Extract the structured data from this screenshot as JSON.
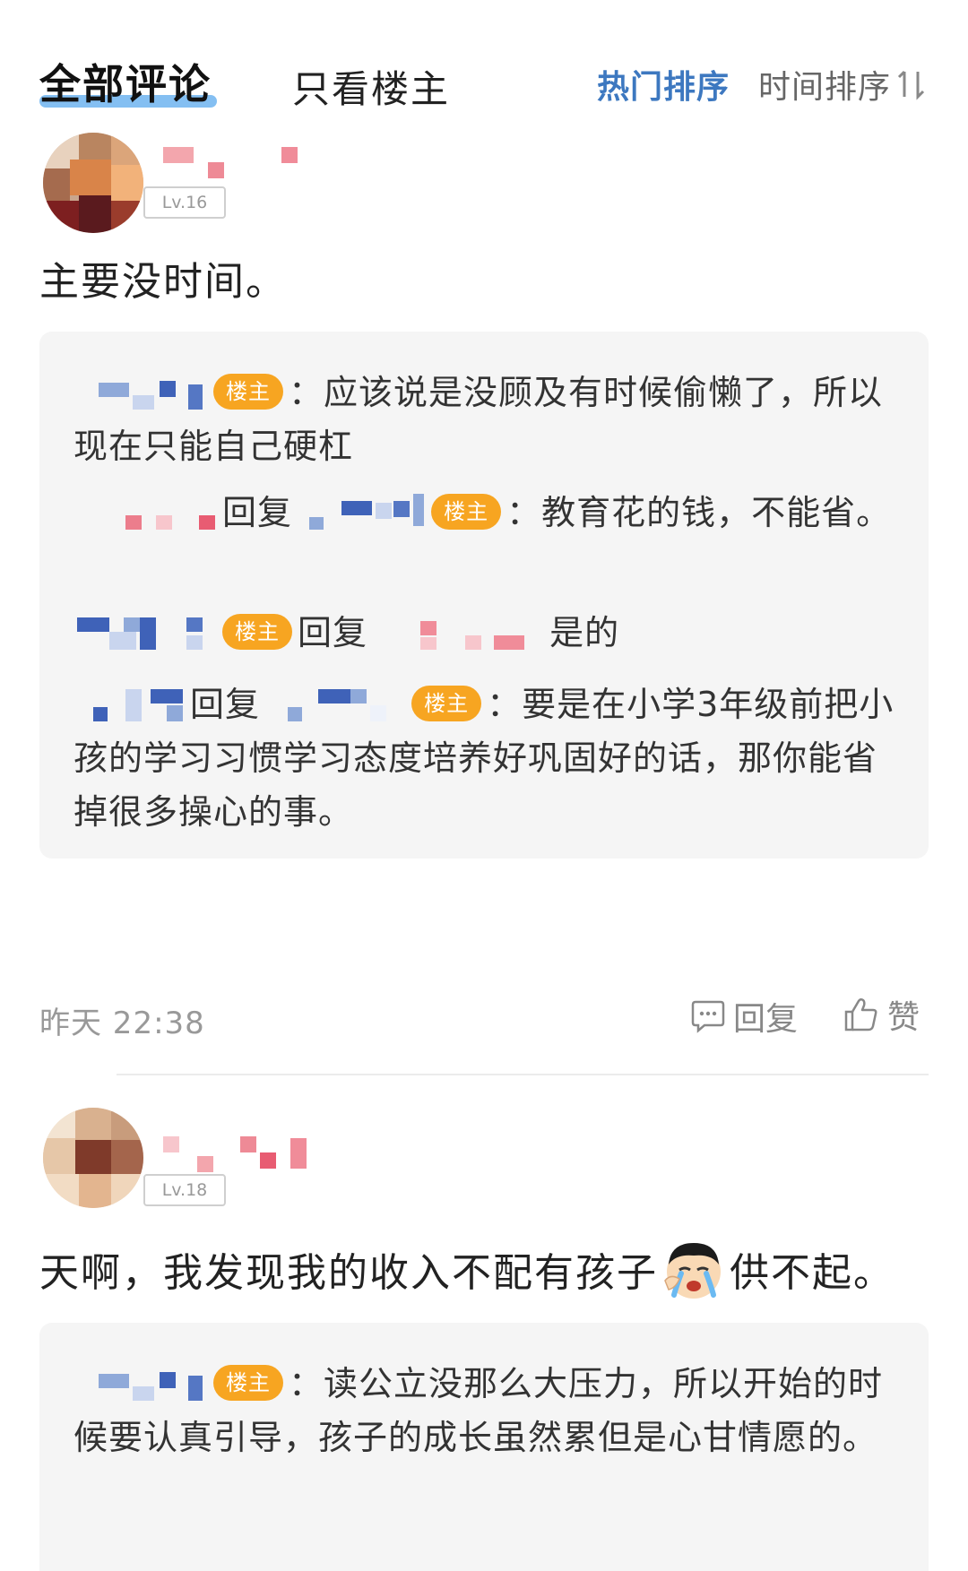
{
  "tabs": {
    "all_comments": "全部评论",
    "op_only": "只看楼主",
    "sort_hot": "热门排序",
    "sort_time": "时间排序"
  },
  "comments": [
    {
      "level": "Lv.16",
      "text": "主要没时间。",
      "replies": [
        {
          "text": "：应该说是没顾及有时候偷懒了，所以现在只能自己硬杠",
          "badge": "楼主"
        },
        {
          "reply_word": "回复",
          "badge": "楼主",
          "text": "：教育花的钱，不能省。"
        },
        {
          "badge": "楼主",
          "reply_word": "回复",
          "text": "是的"
        },
        {
          "reply_word": "回复",
          "badge": "楼主",
          "text": "：要是在小学3年级前把小孩的学习习惯学习态度培养好巩固好的话，那你能省掉很多操心的事。"
        }
      ],
      "time": "昨天 22:38",
      "reply_label": "回复",
      "like_label": "赞"
    },
    {
      "level": "Lv.18",
      "text_before_emoji": "天啊，我发现我的收入不配有孩子",
      "emoji": "crying-face-icon",
      "text_after_emoji": "供不起。",
      "replies": [
        {
          "badge": "楼主",
          "text": "：读公立没那么大压力，所以开始的时候要认真引导，孩子的成长虽然累但是心甘情愿的。"
        }
      ]
    }
  ],
  "colors": {
    "accent_blue": "#3d78c0",
    "badge_orange": "#f7a521",
    "reply_bg": "#f5f5f5"
  }
}
